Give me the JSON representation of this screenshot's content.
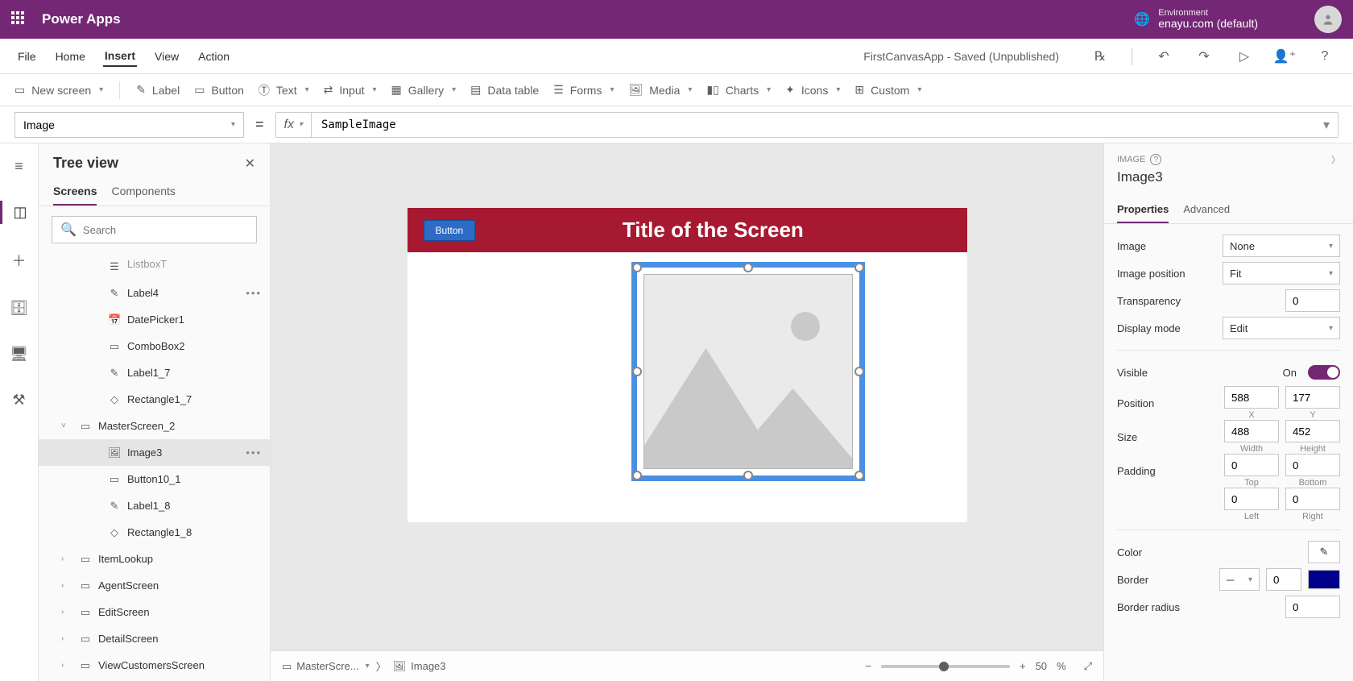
{
  "topbar": {
    "app_name": "Power Apps",
    "env_label": "Environment",
    "env_name": "enayu.com (default)"
  },
  "menubar": {
    "items": [
      "File",
      "Home",
      "Insert",
      "View",
      "Action"
    ],
    "active": "Insert",
    "status": "FirstCanvasApp - Saved (Unpublished)"
  },
  "ribbon": {
    "new_screen": "New screen",
    "label": "Label",
    "button": "Button",
    "text": "Text",
    "input": "Input",
    "gallery": "Gallery",
    "data_table": "Data table",
    "forms": "Forms",
    "media": "Media",
    "charts": "Charts",
    "icons": "Icons",
    "custom": "Custom"
  },
  "formula": {
    "property": "Image",
    "value": "SampleImage"
  },
  "tree": {
    "title": "Tree view",
    "tabs": [
      "Screens",
      "Components"
    ],
    "active_tab": "Screens",
    "search_placeholder": "Search",
    "nodes": [
      {
        "name": "ListboxT",
        "icon": "listbox",
        "indent": 3,
        "cut": true
      },
      {
        "name": "Label4",
        "icon": "pencil",
        "indent": 3,
        "more": true
      },
      {
        "name": "DatePicker1",
        "icon": "calendar",
        "indent": 3
      },
      {
        "name": "ComboBox2",
        "icon": "combo",
        "indent": 3
      },
      {
        "name": "Label1_7",
        "icon": "pencil",
        "indent": 3
      },
      {
        "name": "Rectangle1_7",
        "icon": "shape",
        "indent": 3
      },
      {
        "name": "MasterScreen_2",
        "icon": "screen",
        "indent": 1,
        "toggle": "down"
      },
      {
        "name": "Image3",
        "icon": "image",
        "indent": 3,
        "selected": true,
        "more": true
      },
      {
        "name": "Button10_1",
        "icon": "button",
        "indent": 3
      },
      {
        "name": "Label1_8",
        "icon": "pencil",
        "indent": 3
      },
      {
        "name": "Rectangle1_8",
        "icon": "shape",
        "indent": 3
      },
      {
        "name": "ItemLookup",
        "icon": "screen",
        "indent": 1,
        "toggle": "right"
      },
      {
        "name": "AgentScreen",
        "icon": "screen",
        "indent": 1,
        "toggle": "right"
      },
      {
        "name": "EditScreen",
        "icon": "screen",
        "indent": 1,
        "toggle": "right"
      },
      {
        "name": "DetailScreen",
        "icon": "screen",
        "indent": 1,
        "toggle": "right"
      },
      {
        "name": "ViewCustomersScreen",
        "icon": "screen",
        "indent": 1,
        "toggle": "right"
      }
    ]
  },
  "canvas": {
    "screen_title": "Title of the Screen",
    "button_label": "Button",
    "breadcrumb_screen": "MasterScre...",
    "breadcrumb_control": "Image3",
    "zoom": "50",
    "zoom_suffix": "%"
  },
  "props": {
    "type": "IMAGE",
    "name": "Image3",
    "tabs": [
      "Properties",
      "Advanced"
    ],
    "active_tab": "Properties",
    "image_label": "Image",
    "image_value": "None",
    "image_position_label": "Image position",
    "image_position_value": "Fit",
    "transparency_label": "Transparency",
    "transparency_value": "0",
    "display_mode_label": "Display mode",
    "display_mode_value": "Edit",
    "visible_label": "Visible",
    "visible_value": "On",
    "position_label": "Position",
    "pos_x": "588",
    "pos_x_sub": "X",
    "pos_y": "177",
    "pos_y_sub": "Y",
    "size_label": "Size",
    "size_w": "488",
    "size_w_sub": "Width",
    "size_h": "452",
    "size_h_sub": "Height",
    "padding_label": "Padding",
    "pad_top": "0",
    "pad_top_sub": "Top",
    "pad_bottom": "0",
    "pad_bottom_sub": "Bottom",
    "pad_left": "0",
    "pad_left_sub": "Left",
    "pad_right": "0",
    "pad_right_sub": "Right",
    "color_label": "Color",
    "border_label": "Border",
    "border_value": "0",
    "border_radius_label": "Border radius",
    "border_radius_value": "0"
  }
}
